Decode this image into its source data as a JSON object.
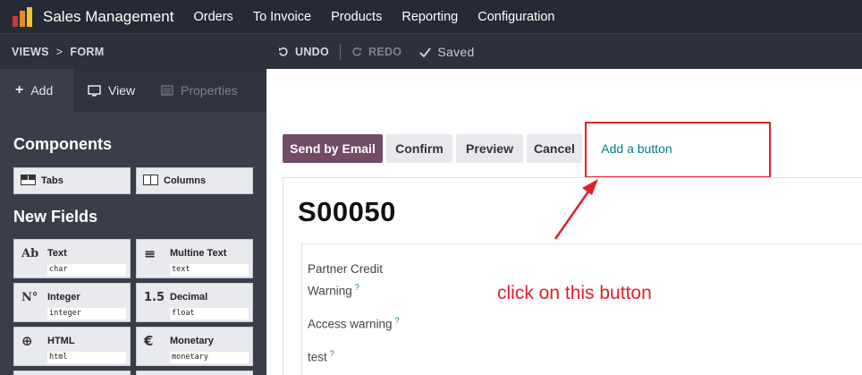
{
  "app": {
    "name": "Sales Management",
    "logo_colors": [
      "#c53b3b",
      "#e38c2a",
      "#f1c232"
    ]
  },
  "menu": [
    "Orders",
    "To Invoice",
    "Products",
    "Reporting",
    "Configuration"
  ],
  "breadcrumb": {
    "views": "VIEWS",
    "sep": ">",
    "form": "FORM"
  },
  "history": {
    "undo": "UNDO",
    "redo": "REDO",
    "saved": "Saved"
  },
  "sidebar": {
    "tabs": {
      "add": "Add",
      "view": "View",
      "properties": "Properties"
    },
    "components_title": "Components",
    "components": [
      {
        "label": "Tabs",
        "icon": "tabs-icon"
      },
      {
        "label": "Columns",
        "icon": "columns-icon"
      }
    ],
    "new_fields_title": "New Fields",
    "fields": [
      {
        "label": "Text",
        "type": "char",
        "icon_text": "Ab"
      },
      {
        "label": "Multine Text",
        "type": "text",
        "icon_text": "≡"
      },
      {
        "label": "Integer",
        "type": "integer",
        "icon_text": "N°"
      },
      {
        "label": "Decimal",
        "type": "float",
        "icon_text": "1.5"
      },
      {
        "label": "HTML",
        "type": "html",
        "icon_text": "⊕"
      },
      {
        "label": "Monetary",
        "type": "monetary",
        "icon_text": "€"
      }
    ]
  },
  "form": {
    "buttons": {
      "send_by_email": "Send by Email",
      "confirm": "Confirm",
      "preview": "Preview",
      "cancel": "Cancel",
      "add_a_button": "Add a button"
    },
    "record_name": "S00050",
    "fields": {
      "partner_credit_1": "Partner Credit",
      "partner_credit_2": "Warning",
      "access_warning": "Access warning",
      "test": "test",
      "help_mark": "?"
    }
  },
  "annotation": {
    "text": "click on this button",
    "color": "#e0202a"
  },
  "colors": {
    "primary": "#714b67",
    "accent": "#017e84"
  }
}
